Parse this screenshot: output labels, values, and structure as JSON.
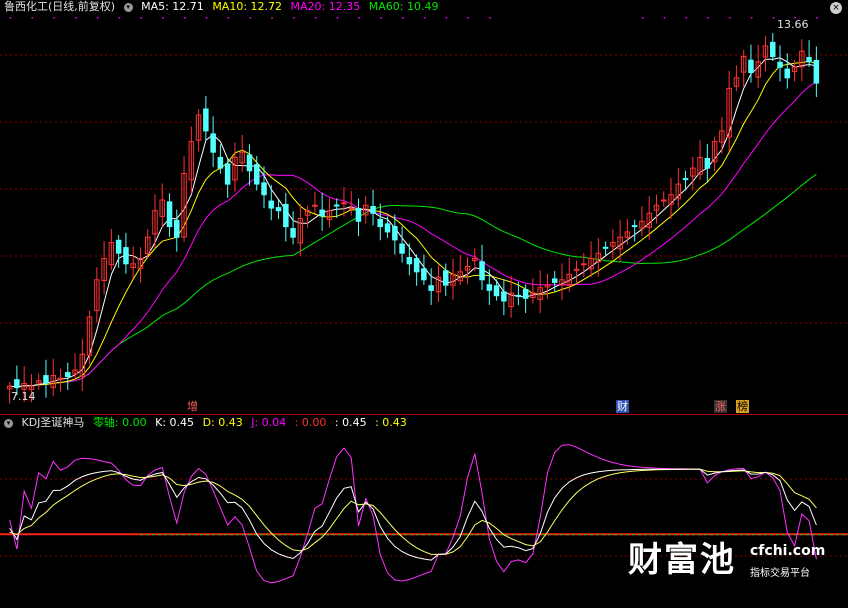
{
  "header": {
    "stock_title": "鲁西化工(日线,前复权)",
    "ma5_label": "MA5: 12.71",
    "ma10_label": "MA10: 12.72",
    "ma20_label": "MA20: 12.35",
    "ma60_label": "MA60: 10.49"
  },
  "price_labels": {
    "high": "13.66",
    "low": "7.14"
  },
  "markers": {
    "zeng": "增",
    "cai": "财",
    "zhang": "涨",
    "bang": "榜"
  },
  "indicator": {
    "name": "KDJ圣诞神马",
    "zero_axis": "零轴: 0.00",
    "k": "K: 0.45",
    "d": "D: 0.43",
    "j": "J: 0.04",
    "red_val": ": 0.00",
    "v1": ": 0.45",
    "v2": ": 0.43"
  },
  "watermark": {
    "brand": "财富池",
    "site": "cfchi.com",
    "slogan": "指标交易平台"
  },
  "colors": {
    "up": "#ff3232",
    "down": "#54ffff",
    "ma5": "#ffffff",
    "ma10": "#ffff00",
    "ma20": "#ff00ff",
    "ma60": "#00e600",
    "grid": "#8b0000",
    "zero": "#ff2020",
    "kline": "#ffffff",
    "dline": "#ffff66",
    "jline": "#ff33ff",
    "jlow": "#33ff33"
  },
  "chart_data": {
    "type": "candlestick",
    "price_range": [
      6.9,
      14.2
    ],
    "closes": [
      7.2,
      7.17,
      7.25,
      7.2,
      7.3,
      7.26,
      7.4,
      7.35,
      7.38,
      7.5,
      7.8,
      8.5,
      9.2,
      9.6,
      9.9,
      9.7,
      9.5,
      9.5,
      9.6,
      10,
      10.5,
      10.7,
      10.2,
      10.0,
      11.2,
      11.8,
      12.3,
      12.0,
      11.6,
      11.3,
      11.0,
      11.5,
      11.6,
      11.25,
      11.0,
      10.8,
      10.55,
      10.5,
      10.2,
      10.0,
      10.35,
      10.5,
      10.6,
      10.4,
      10.5,
      10.6,
      10.65,
      10.55,
      10.3,
      10.6,
      10.45,
      10.2,
      10.1,
      9.95,
      9.7,
      9.5,
      9.35,
      9.2,
      9.0,
      9.25,
      9.1,
      9.3,
      9.35,
      9.45,
      9.6,
      9.2,
      9.0,
      8.9,
      8.8,
      8.95,
      8.9,
      8.85,
      8.95,
      9.05,
      9.1,
      9.15,
      9.2,
      9.3,
      9.4,
      9.5,
      9.6,
      9.7,
      9.8,
      9.9,
      10.0,
      10.1,
      10.2,
      10.3,
      10.45,
      10.6,
      10.7,
      10.8,
      11.0,
      11.1,
      11.3,
      11.5,
      11.3,
      11.8,
      12.0,
      12.8,
      13.0,
      13.4,
      13.1,
      13.3,
      13.6,
      13.4,
      13.2,
      13.0,
      13.2,
      13.5,
      13.3,
      12.9
    ],
    "ma_values": {
      "ma5": 12.71,
      "ma10": 12.72,
      "ma20": 12.35,
      "ma60": 10.49
    },
    "kdj_values": {
      "zero": 0.0,
      "k": 0.45,
      "d": 0.43,
      "j": 0.04
    },
    "kdj_range": [
      -0.75,
      1.1
    ],
    "markers": [
      {
        "text": "增",
        "bar": 18
      },
      {
        "text": "财",
        "bar": 62
      },
      {
        "text": "涨",
        "bar": 83
      },
      {
        "text": "榜",
        "bar": 87
      }
    ]
  }
}
